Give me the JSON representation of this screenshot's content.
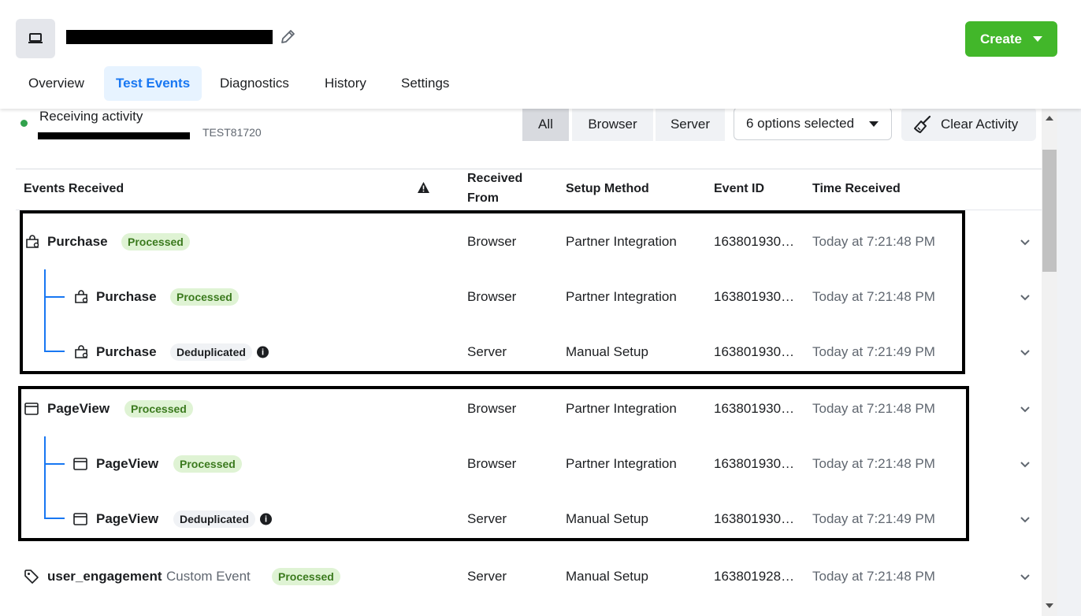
{
  "header": {
    "create_label": "Create",
    "tabs": [
      "Overview",
      "Test Events",
      "Diagnostics",
      "History",
      "Settings"
    ]
  },
  "status": {
    "label": "Receiving activity",
    "test_code": "TEST81720"
  },
  "filters": {
    "segments": [
      "All",
      "Browser",
      "Server"
    ],
    "dropdown": "6 options selected",
    "clear_label": "Clear Activity"
  },
  "table": {
    "headers": {
      "events": "Events Received",
      "from_line1": "Received",
      "from_line2": "From",
      "setup": "Setup Method",
      "event_id": "Event ID",
      "time": "Time Received"
    },
    "rows": [
      {
        "name": "Purchase",
        "badge": "Processed",
        "from": "Browser",
        "setup": "Partner Integration",
        "id": "163801930…",
        "time": "Today at 7:21:48 PM"
      },
      {
        "name": "Purchase",
        "badge": "Processed",
        "from": "Browser",
        "setup": "Partner Integration",
        "id": "163801930…",
        "time": "Today at 7:21:48 PM"
      },
      {
        "name": "Purchase",
        "badge": "Deduplicated",
        "from": "Server",
        "setup": "Manual Setup",
        "id": "163801930…",
        "time": "Today at 7:21:49 PM"
      },
      {
        "name": "PageView",
        "badge": "Processed",
        "from": "Browser",
        "setup": "Partner Integration",
        "id": "163801930…",
        "time": "Today at 7:21:48 PM"
      },
      {
        "name": "PageView",
        "badge": "Processed",
        "from": "Browser",
        "setup": "Partner Integration",
        "id": "163801930…",
        "time": "Today at 7:21:48 PM"
      },
      {
        "name": "PageView",
        "badge": "Deduplicated",
        "from": "Server",
        "setup": "Manual Setup",
        "id": "163801930…",
        "time": "Today at 7:21:49 PM"
      },
      {
        "name": "user_engagement",
        "type": "Custom Event",
        "badge": "Processed",
        "from": "Server",
        "setup": "Manual Setup",
        "id": "163801928…",
        "time": "Today at 7:21:48 PM"
      }
    ]
  },
  "colors": {
    "accent": "#1877f2",
    "create": "#42b72a",
    "processed_bg": "#dff3d4",
    "processed_text": "#3b7a1e"
  }
}
